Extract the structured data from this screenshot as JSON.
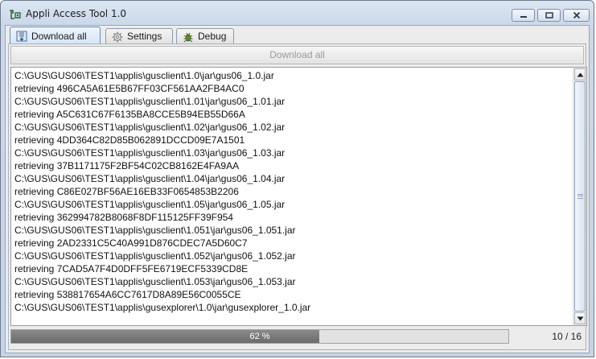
{
  "window": {
    "title": "Appli Access Tool 1.0"
  },
  "tabs": [
    {
      "label": "Download all",
      "icon": "download-icon"
    },
    {
      "label": "Settings",
      "icon": "gear-icon"
    },
    {
      "label": "Debug",
      "icon": "bug-icon"
    }
  ],
  "active_tab": "Download all",
  "download_button": {
    "label": "Download all",
    "enabled": false
  },
  "log_lines": [
    "C:\\GUS\\GUS06\\TEST1\\applis\\gusclient\\1.0\\jar\\gus06_1.0.jar",
    "retrieving 496CA5A61E5B67FF03CF561AA2FB4AC0",
    "C:\\GUS\\GUS06\\TEST1\\applis\\gusclient\\1.01\\jar\\gus06_1.01.jar",
    "retrieving A5C631C67F6135BA8CCE5B94EB55D66A",
    "C:\\GUS\\GUS06\\TEST1\\applis\\gusclient\\1.02\\jar\\gus06_1.02.jar",
    "retrieving 4DD364C82D85B062891DCCD09E7A1501",
    "C:\\GUS\\GUS06\\TEST1\\applis\\gusclient\\1.03\\jar\\gus06_1.03.jar",
    "retrieving 37B1171175F2BF54C02CB8162E4FA9AA",
    "C:\\GUS\\GUS06\\TEST1\\applis\\gusclient\\1.04\\jar\\gus06_1.04.jar",
    "retrieving C86E027BF56AE16EB33F0654853B2206",
    "C:\\GUS\\GUS06\\TEST1\\applis\\gusclient\\1.05\\jar\\gus06_1.05.jar",
    "retrieving 362994782B8068F8DF115125FF39F954",
    "C:\\GUS\\GUS06\\TEST1\\applis\\gusclient\\1.051\\jar\\gus06_1.051.jar",
    "retrieving 2AD2331C5C40A991D876CDEC7A5D60C7",
    "C:\\GUS\\GUS06\\TEST1\\applis\\gusclient\\1.052\\jar\\gus06_1.052.jar",
    "retrieving 7CAD5A7F4D0DFF5FE6719ECF5339CD8E",
    "C:\\GUS\\GUS06\\TEST1\\applis\\gusclient\\1.053\\jar\\gus06_1.053.jar",
    "retrieving 538817654A6CC7617D8A89E56C0055CE",
    "C:\\GUS\\GUS06\\TEST1\\applis\\gusexplorer\\1.0\\jar\\gusexplorer_1.0.jar"
  ],
  "progress": {
    "label": "62 %",
    "fraction": 0.62
  },
  "counter": "10 / 16"
}
